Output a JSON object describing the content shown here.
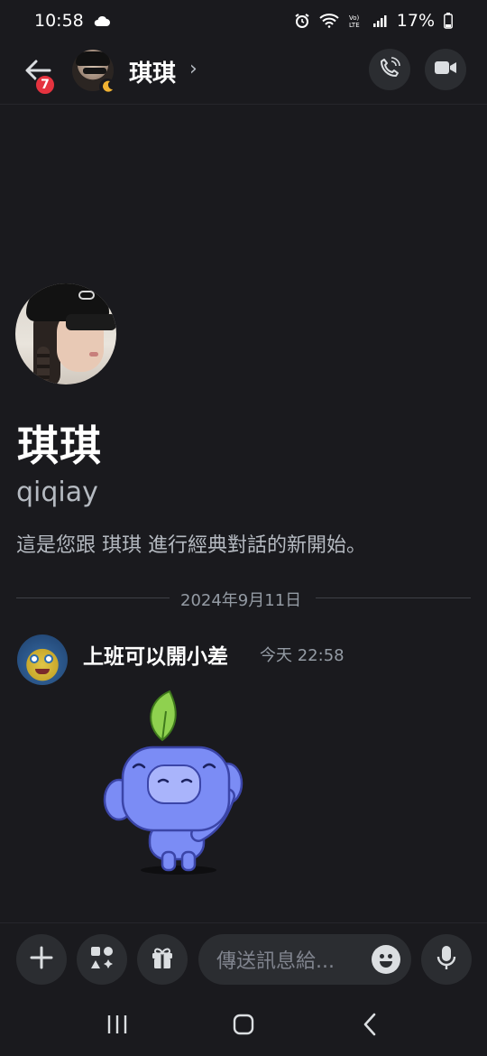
{
  "status_bar": {
    "time": "10:58",
    "battery": "17%",
    "icons": [
      "cloud-icon",
      "alarm-icon",
      "wifi-icon",
      "volte-icon",
      "signal-icon",
      "battery-icon"
    ]
  },
  "header": {
    "unread_count": "7",
    "name": "琪琪",
    "chevron": "›",
    "icons": [
      "back-arrow-icon",
      "moon-status-icon",
      "voice-call-icon",
      "video-call-icon"
    ]
  },
  "profile": {
    "display_name": "琪琪",
    "username": "qiqiay",
    "intro": "這是您跟 琪琪 進行經典對話的新開始。"
  },
  "messages": {
    "date_divider": "2024年9月11日",
    "items": [
      {
        "author": "上班可以開小差",
        "time": "今天 22:58",
        "content_type": "sticker"
      }
    ]
  },
  "composer": {
    "placeholder": "傳送訊息給...",
    "icons": [
      "plus-icon",
      "apps-icon",
      "gift-icon",
      "emoji-icon",
      "microphone-icon"
    ]
  },
  "nav_bar": {
    "icons": [
      "recent-apps-icon",
      "home-icon",
      "back-icon"
    ]
  },
  "colors": {
    "background": "#1a1a1e",
    "surface": "#2b2d31",
    "badge_red": "#e5333f",
    "muted_text": "#b5bac1",
    "timestamp": "#949ba4",
    "sticker_blue": "#7b8cf5",
    "leaf_green": "#8fd14f"
  }
}
